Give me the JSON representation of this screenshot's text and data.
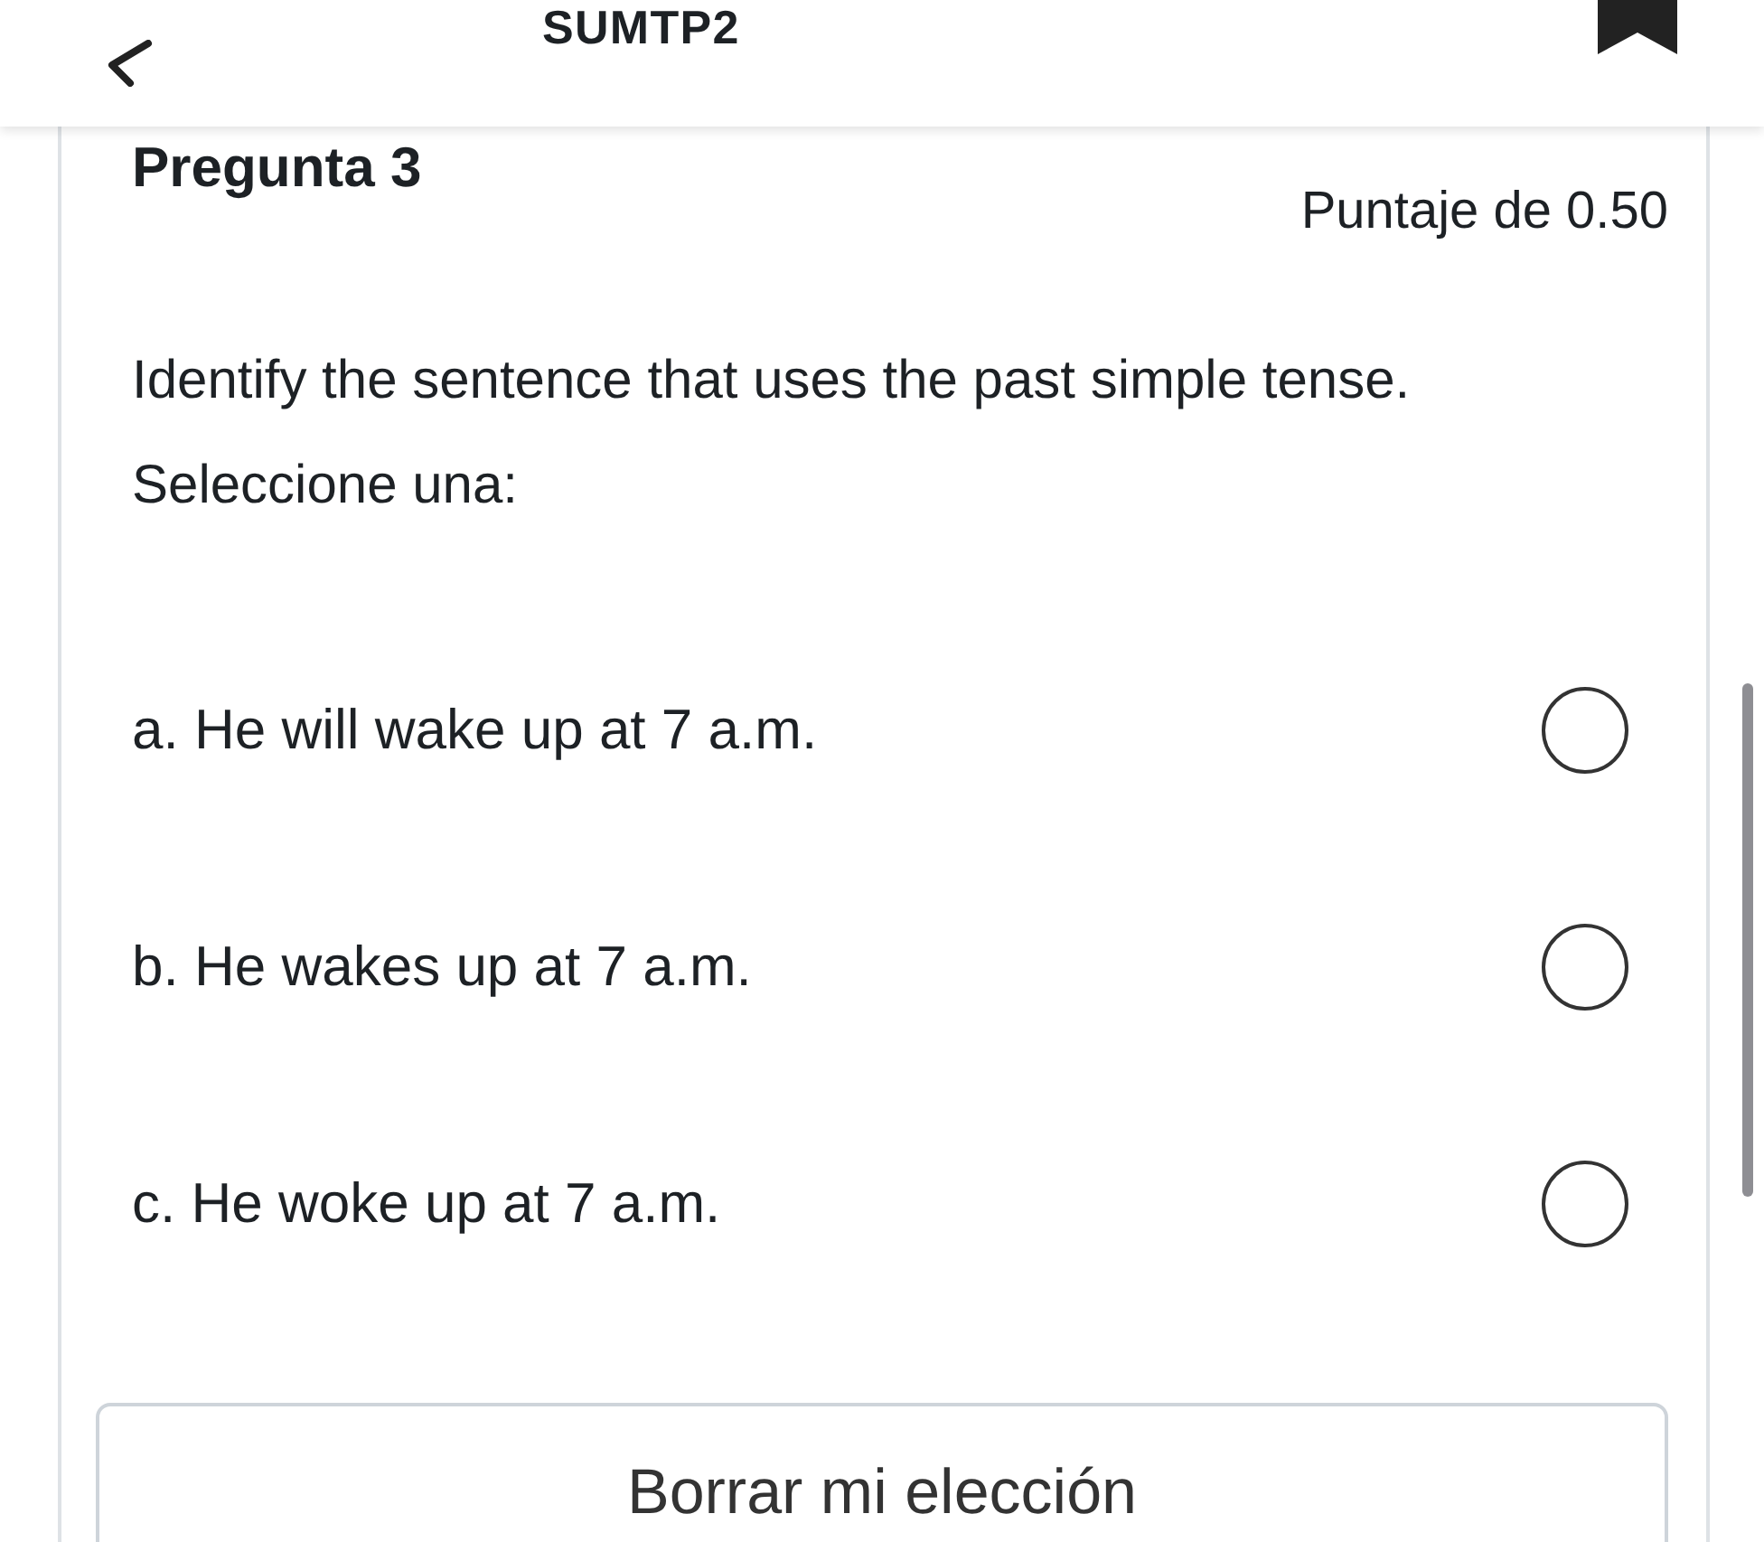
{
  "header": {
    "title": "SUMTP2"
  },
  "question": {
    "title": "Pregunta 3",
    "score": "Puntaje de 0.50",
    "text": "Identify the sentence that uses the past simple tense.",
    "prompt": "Seleccione una:",
    "options": [
      {
        "label": "a. He will wake up at 7 a.m.",
        "selected": false
      },
      {
        "label": "b. He wakes up at 7 a.m.",
        "selected": false
      },
      {
        "label": "c. He woke up at 7 a.m.",
        "selected": false
      }
    ],
    "clear_button": "Borrar mi elección"
  }
}
